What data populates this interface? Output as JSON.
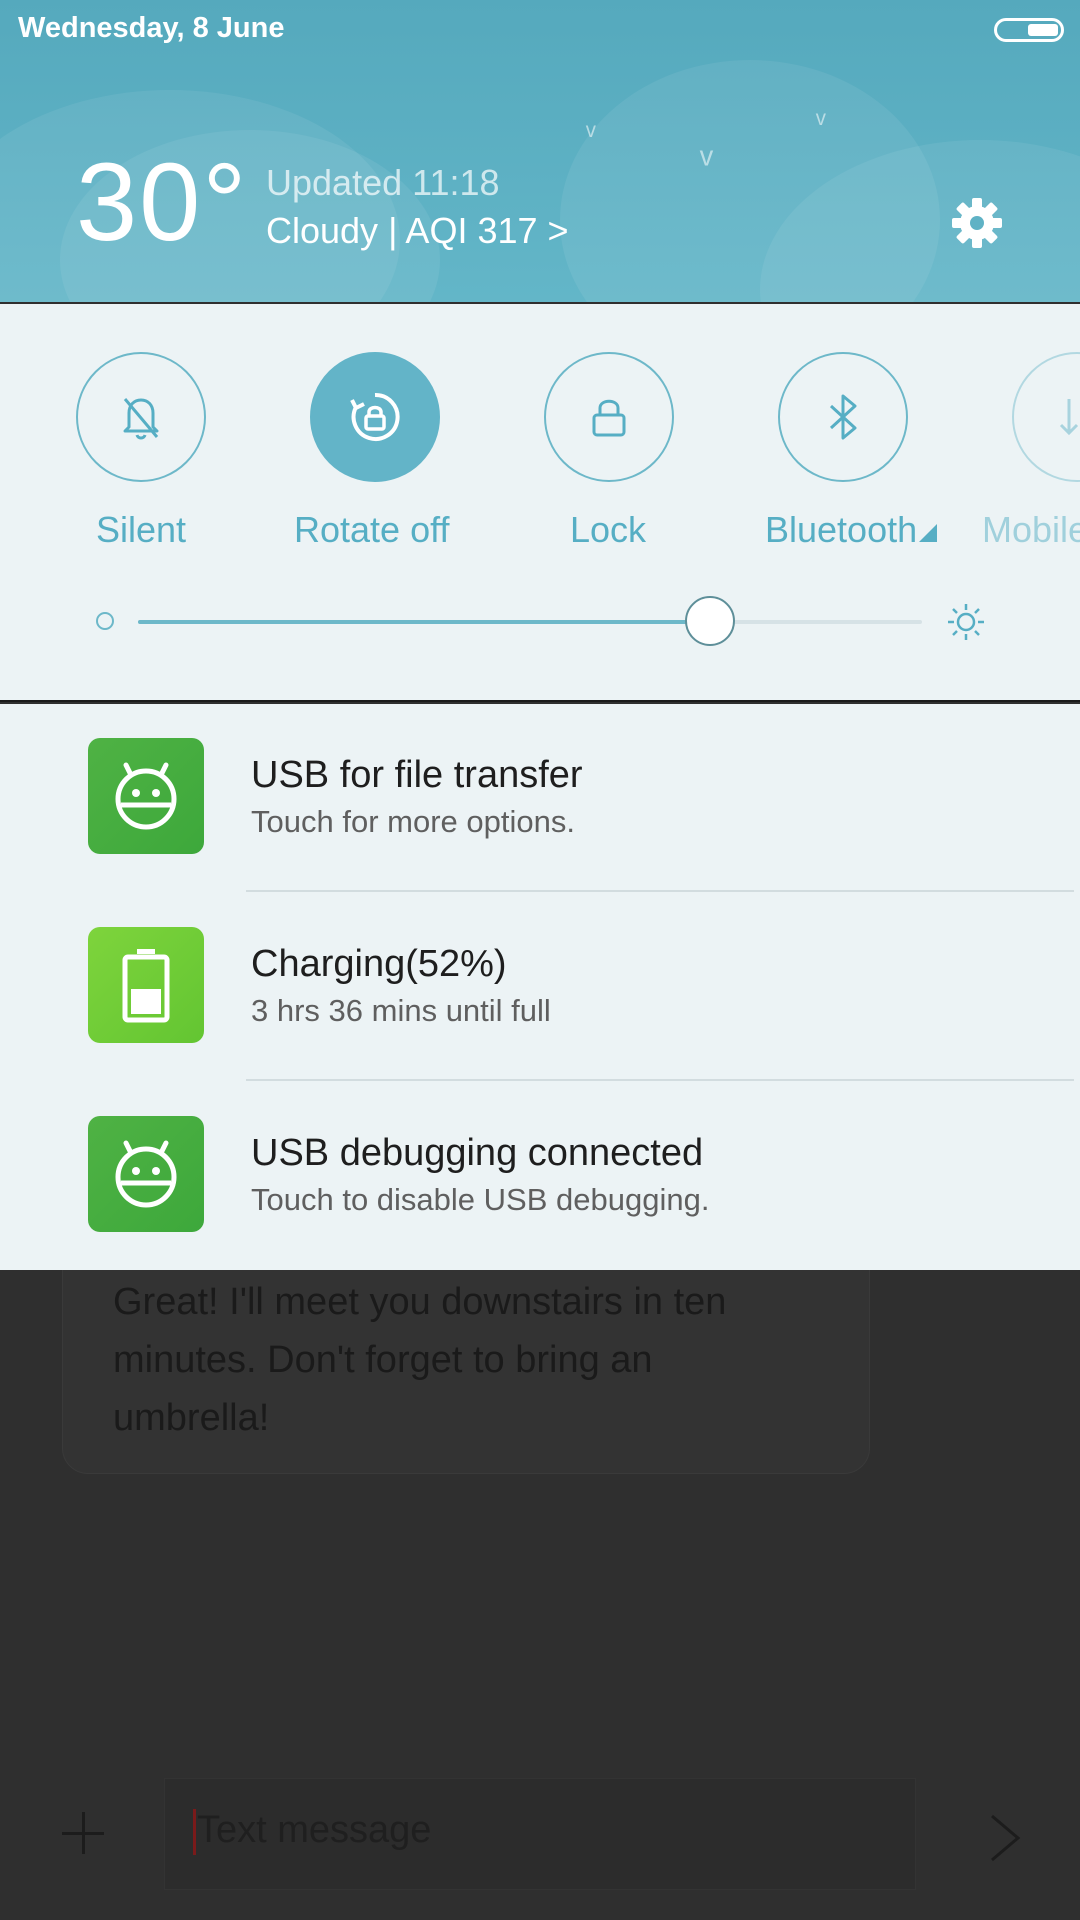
{
  "status_bar": {
    "date": "Wednesday, 8 June"
  },
  "weather": {
    "temperature": "30°",
    "updated": "Updated 11:18",
    "condition": "Cloudy | AQI 317 >"
  },
  "quick_settings": {
    "tiles": [
      {
        "label": "Silent",
        "icon": "bell-off-icon",
        "active": false
      },
      {
        "label": "Rotate off",
        "icon": "rotate-lock-icon",
        "active": true
      },
      {
        "label": "Lock",
        "icon": "lock-icon",
        "active": false
      },
      {
        "label": "Bluetooth",
        "icon": "bluetooth-icon",
        "active": false
      },
      {
        "label": "Mobile",
        "icon": "mobile-data-icon",
        "active": false
      }
    ],
    "brightness": 0.73
  },
  "notifications": [
    {
      "title": "USB for file transfer",
      "subtitle": "Touch for more options.",
      "icon": "android-icon",
      "color": "#45ad3f"
    },
    {
      "title": "Charging(52%)",
      "subtitle": "3 hrs 36 mins until full",
      "icon": "battery-icon",
      "color": "#6fcd39"
    },
    {
      "title": "USB debugging connected",
      "subtitle": "Touch to disable USB debugging.",
      "icon": "android-icon",
      "color": "#45ad3f"
    }
  ],
  "background_app": {
    "message": "Great! I'll meet you downstairs in ten minutes. Don't forget to bring an umbrella!",
    "composer_placeholder": "Text message"
  },
  "colors": {
    "header_bg": "#5cb0c3",
    "accent": "#56aec4",
    "panel_bg": "#ecf3f5"
  }
}
